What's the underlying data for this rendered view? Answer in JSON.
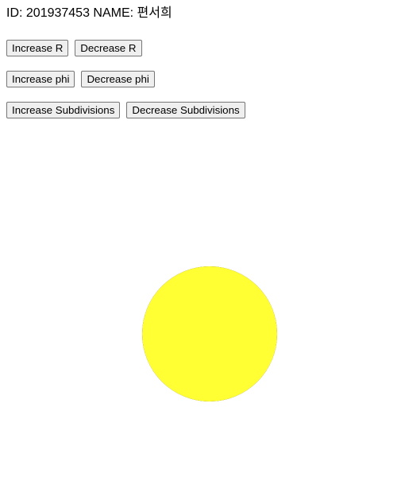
{
  "header": {
    "text": "ID: 201937453 NAME: 편서희"
  },
  "controls": {
    "radius": {
      "increase_label": "Increase R",
      "decrease_label": "Decrease R"
    },
    "phi": {
      "increase_label": "Increase phi",
      "decrease_label": "Decrease phi"
    },
    "subdivisions": {
      "increase_label": "Increase Subdivisions",
      "decrease_label": "Decrease Subdivisions"
    }
  },
  "sphere": {
    "colors": {
      "highlight": "#ffff33",
      "mid": "#ffc235",
      "warm": "#f08a33",
      "shadow": "#300033"
    }
  }
}
